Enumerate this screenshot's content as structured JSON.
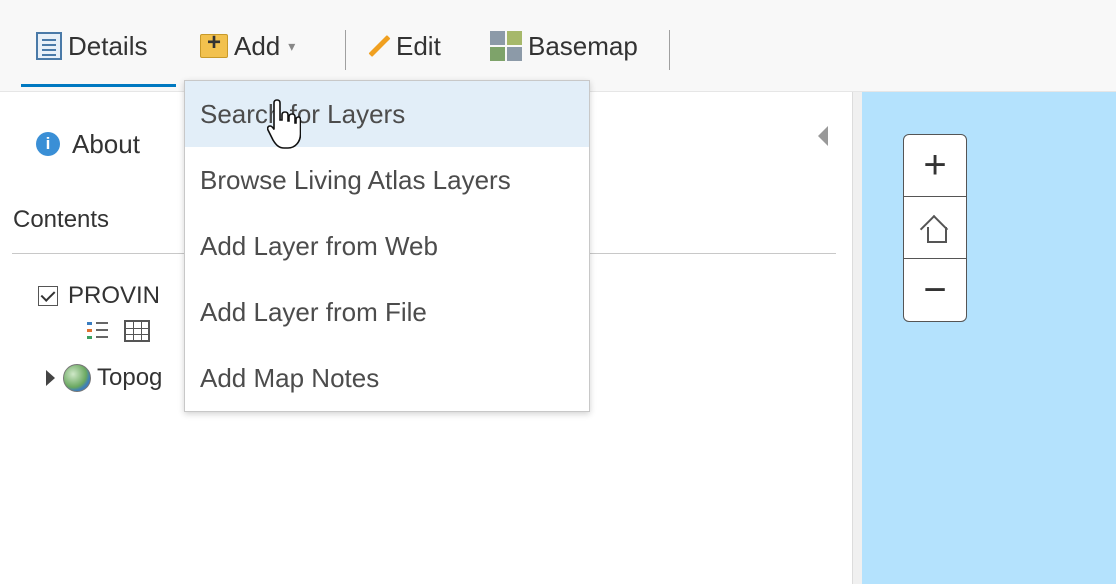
{
  "toolbar": {
    "details_label": "Details",
    "add_label": "Add",
    "edit_label": "Edit",
    "basemap_label": "Basemap",
    "add_caret": "▾"
  },
  "panel": {
    "about_label": "About",
    "info_icon": "i",
    "contents_label": "Contents",
    "layers": [
      {
        "label": "PROVIN",
        "checked": true
      },
      {
        "label": "Topog"
      }
    ]
  },
  "add_menu": {
    "items": [
      {
        "label": "Search for Layers",
        "active": true
      },
      {
        "label": "Browse Living Atlas Layers"
      },
      {
        "label": "Add Layer from Web"
      },
      {
        "label": "Add Layer from File"
      },
      {
        "label": "Add Map Notes"
      }
    ]
  },
  "map": {
    "zoom_in": "+",
    "zoom_out": "−",
    "background_color": "#b4e2fd"
  },
  "colors": {
    "accent": "#0079c1",
    "menu_hover": "#e2eef8"
  }
}
